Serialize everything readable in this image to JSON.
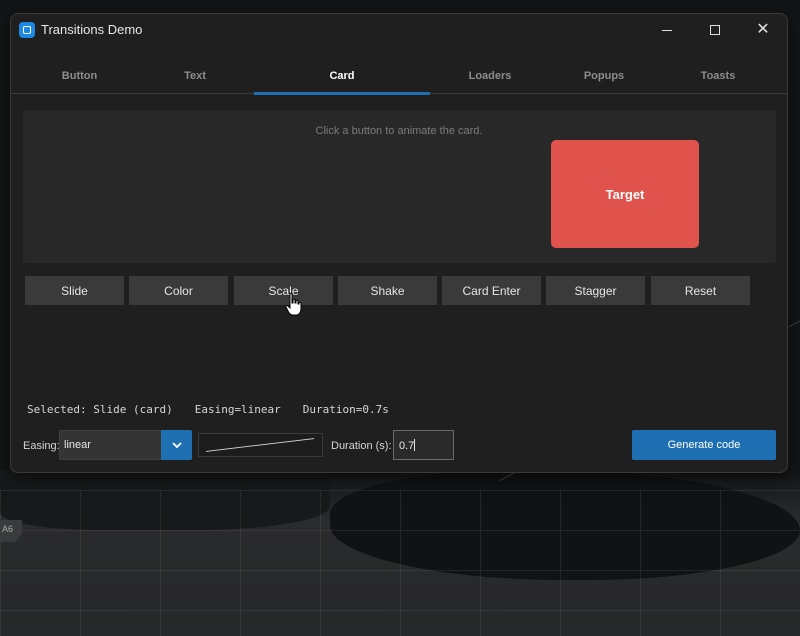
{
  "window": {
    "title": "Transitions Demo"
  },
  "tabs": [
    {
      "label": "Button"
    },
    {
      "label": "Text"
    },
    {
      "label": "Card"
    },
    {
      "label": "Loaders"
    },
    {
      "label": "Popups"
    },
    {
      "label": "Toasts"
    }
  ],
  "active_tab": "Card",
  "stage": {
    "hint": "Click a button to animate the card.",
    "target_label": "Target",
    "target_color": "#e0534d"
  },
  "actions": [
    {
      "label": "Slide"
    },
    {
      "label": "Color"
    },
    {
      "label": "Scale"
    },
    {
      "label": "Shake"
    },
    {
      "label": "Card Enter"
    },
    {
      "label": "Stagger"
    },
    {
      "label": "Reset"
    }
  ],
  "status": {
    "selected": "Selected: Slide (card)",
    "easing": "Easing=linear",
    "duration": "Duration=0.7s"
  },
  "controls": {
    "easing_label": "Easing:",
    "easing_value": "linear",
    "duration_label": "Duration (s):",
    "duration_value": "0.7",
    "generate_label": "Generate code"
  },
  "colors": {
    "accent": "#1f6fb3",
    "window_bg": "#1f1f1f",
    "button_bg": "#3a3a3a"
  }
}
